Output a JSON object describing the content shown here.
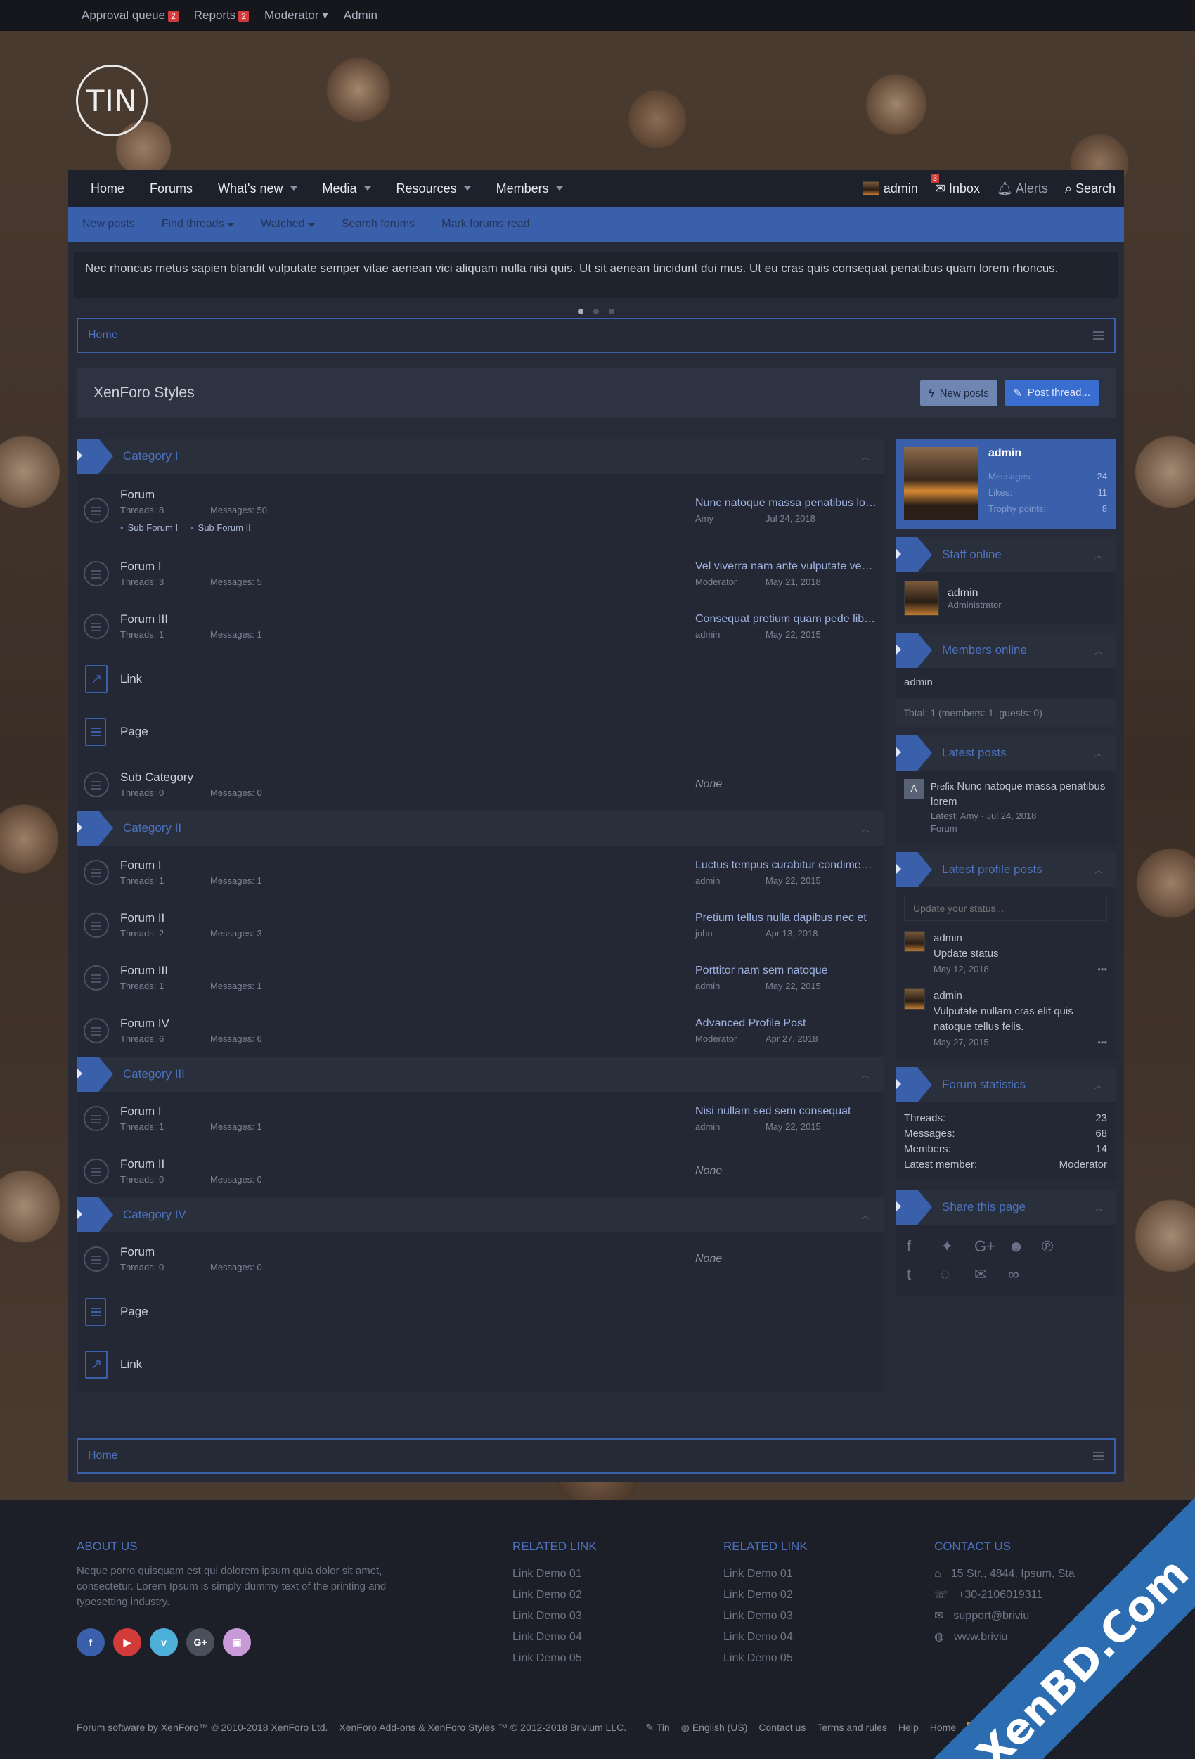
{
  "topbar": {
    "approval": "Approval queue",
    "approval_count": "2",
    "reports": "Reports",
    "reports_count": "2",
    "moderator": "Moderator",
    "admin": "Admin"
  },
  "logo": {
    "text": "TIN"
  },
  "nav": {
    "home": "Home",
    "forums": "Forums",
    "whats_new": "What's new",
    "media": "Media",
    "resources": "Resources",
    "members": "Members",
    "user": "admin",
    "inbox": "Inbox",
    "inbox_count": "3",
    "alerts": "Alerts",
    "search": "Search"
  },
  "subnav": [
    "New posts",
    "Find threads",
    "Watched",
    "Search forums",
    "Mark forums read"
  ],
  "notice": "Nec rhoncus metus sapien blandit vulputate semper vitae aenean vici aliquam nulla nisi quis. Ut sit aenean tincidunt dui mus. Ut eu cras quis consequat penatibus quam lorem rhoncus.",
  "breadcrumb": "Home",
  "page_title": "XenForo Styles",
  "buttons": {
    "new_posts": "New posts",
    "post_thread": "Post thread..."
  },
  "labels": {
    "threads": "Threads:",
    "messages": "Messages:",
    "none": "None"
  },
  "categories": [
    {
      "name": "Category I",
      "rows": [
        {
          "kind": "forum",
          "title": "Forum",
          "threads": "8",
          "messages": "50",
          "subs": [
            "Sub Forum I",
            "Sub Forum II"
          ],
          "last_title": "Nunc natoque massa penatibus lorem",
          "last_user": "Amy",
          "last_date": "Jul 24, 2018"
        },
        {
          "kind": "forum",
          "title": "Forum I",
          "threads": "3",
          "messages": "5",
          "last_title": "Vel viverra nam ante vulputate venenatis",
          "last_user": "Moderator",
          "last_date": "May 21, 2018"
        },
        {
          "kind": "forum",
          "title": "Forum III",
          "threads": "1",
          "messages": "1",
          "last_title": "Consequat pretium quam pede libero",
          "last_user": "admin",
          "last_date": "May 22, 2015"
        },
        {
          "kind": "link",
          "title": "Link"
        },
        {
          "kind": "page",
          "title": "Page"
        },
        {
          "kind": "forum",
          "title": "Sub Category",
          "threads": "0",
          "messages": "0",
          "none": true
        }
      ]
    },
    {
      "name": "Category II",
      "rows": [
        {
          "kind": "forum",
          "title": "Forum I",
          "threads": "1",
          "messages": "1",
          "last_title": "Luctus tempus curabitur condimentum",
          "last_user": "admin",
          "last_date": "May 22, 2015"
        },
        {
          "kind": "forum",
          "title": "Forum II",
          "threads": "2",
          "messages": "3",
          "last_title": "Pretium tellus nulla dapibus nec et",
          "last_user": "john",
          "last_date": "Apr 13, 2018"
        },
        {
          "kind": "forum",
          "title": "Forum III",
          "threads": "1",
          "messages": "1",
          "last_title": "Porttitor nam sem natoque",
          "last_user": "admin",
          "last_date": "May 22, 2015"
        },
        {
          "kind": "forum",
          "title": "Forum IV",
          "threads": "6",
          "messages": "6",
          "last_title": "Advanced Profile Post",
          "last_user": "Moderator",
          "last_date": "Apr 27, 2018"
        }
      ]
    },
    {
      "name": "Category III",
      "rows": [
        {
          "kind": "forum",
          "title": "Forum I",
          "threads": "1",
          "messages": "1",
          "last_title": "Nisi nullam sed sem consequat",
          "last_user": "admin",
          "last_date": "May 22, 2015"
        },
        {
          "kind": "forum",
          "title": "Forum II",
          "threads": "0",
          "messages": "0",
          "none": true
        }
      ]
    },
    {
      "name": "Category IV",
      "rows": [
        {
          "kind": "forum",
          "title": "Forum",
          "threads": "0",
          "messages": "0",
          "none": true
        },
        {
          "kind": "page",
          "title": "Page"
        },
        {
          "kind": "link",
          "title": "Link"
        }
      ]
    }
  ],
  "sidebar": {
    "user": {
      "name": "admin",
      "messages_label": "Messages:",
      "messages": "24",
      "likes_label": "Likes:",
      "likes": "11",
      "trophy_label": "Trophy points:",
      "trophy": "8"
    },
    "staff_online": {
      "title": "Staff online",
      "name": "admin",
      "role": "Administrator"
    },
    "members_online": {
      "title": "Members online",
      "name": "admin",
      "total": "Total: 1 (members: 1, guests: 0)"
    },
    "latest_posts": {
      "title": "Latest posts",
      "letter": "A",
      "prefix": "Prefix",
      "post_title": "Nunc natoque massa penatibus lorem",
      "meta": "Latest: Amy · Jul 24, 2018",
      "forum": "Forum"
    },
    "latest_profile_posts": {
      "title": "Latest profile posts",
      "placeholder": "Update your status...",
      "posts": [
        {
          "user": "admin",
          "text": "Update status",
          "date": "May 12, 2018"
        },
        {
          "user": "admin",
          "text": "Vulputate nullam cras elit quis natoque tellus felis.",
          "date": "May 27, 2015"
        }
      ]
    },
    "stats": {
      "title": "Forum statistics",
      "threads_label": "Threads:",
      "threads": "23",
      "messages_label": "Messages:",
      "messages": "68",
      "members_label": "Members:",
      "members": "14",
      "latest_label": "Latest member:",
      "latest": "Moderator"
    },
    "share": {
      "title": "Share this page"
    }
  },
  "footer": {
    "about_title": "ABOUT US",
    "about_text": "Neque porro quisquam est qui dolorem ipsum quia dolor sit amet, consectetur. Lorem Ipsum is simply dummy text of the printing and typesetting industry.",
    "related1_title": "RELATED LINK",
    "related2_title": "RELATED LINK",
    "links": [
      "Link Demo 01",
      "Link Demo 02",
      "Link Demo 03",
      "Link Demo 04",
      "Link Demo 05"
    ],
    "contact_title": "CONTACT US",
    "contact": [
      "15 Str., 4844, Ipsum, Sta",
      "+30-2106019311",
      "support@briviu",
      "www.briviu"
    ],
    "copyright": "Forum software by XenForo™ © 2010-2018 XenForo Ltd.",
    "copyright2": "XenForo Add-ons & XenForo Styles ™ © 2012-2018 Brivium LLC.",
    "style": "Tin",
    "language": "English (US)",
    "contact_us": "Contact us",
    "terms": "Terms and rules",
    "help": "Help",
    "home": "Home"
  },
  "watermark": "XenBD.Com"
}
